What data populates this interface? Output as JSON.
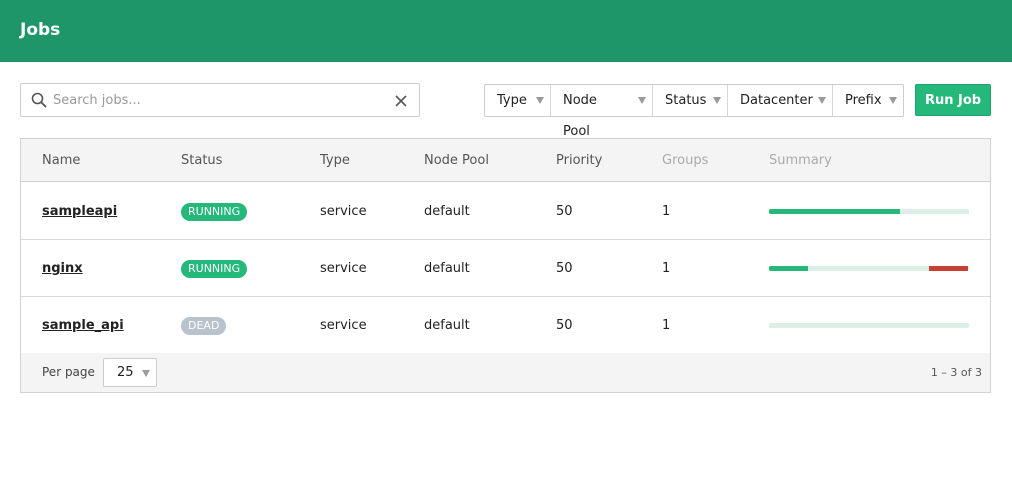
{
  "header": {
    "title": "Jobs",
    "color": "#1e966a"
  },
  "search": {
    "placeholder": "Search jobs...",
    "value": "",
    "icon": "search-icon",
    "clear_icon": "close-icon"
  },
  "filters": [
    {
      "label": "Type"
    },
    {
      "label": "Node Pool"
    },
    {
      "label": "Status"
    },
    {
      "label": "Datacenter"
    },
    {
      "label": "Prefix"
    }
  ],
  "actions": {
    "run_job": "Run Job",
    "color": "#25b87b"
  },
  "table": {
    "columns": [
      "Name",
      "Status",
      "Type",
      "Node Pool",
      "Priority",
      "Groups",
      "Summary"
    ],
    "rows": [
      {
        "name": "sampleapi",
        "status": "RUNNING",
        "type": "service",
        "node_pool": "default",
        "priority": "50",
        "groups": "1",
        "summary": [
          {
            "state": "running",
            "fraction": 0.66,
            "color": "#25b87b"
          },
          {
            "state": "empty",
            "fraction": 0.34,
            "color": "#dcefe7"
          }
        ]
      },
      {
        "name": "nginx",
        "status": "RUNNING",
        "type": "service",
        "node_pool": "default",
        "priority": "50",
        "groups": "1",
        "summary": [
          {
            "state": "running",
            "fraction": 0.2,
            "color": "#25b87b"
          },
          {
            "state": "empty",
            "fraction": 0.6,
            "color": "#dcefe7"
          },
          {
            "state": "failed",
            "fraction": 0.2,
            "color": "#c84034"
          }
        ]
      },
      {
        "name": "sample_api",
        "status": "DEAD",
        "type": "service",
        "node_pool": "default",
        "priority": "50",
        "groups": "1",
        "summary": [
          {
            "state": "empty",
            "fraction": 1.0,
            "color": "#dcefe7"
          }
        ]
      }
    ]
  },
  "footer": {
    "per_page_label": "Per page",
    "per_page_value": "25",
    "range": "1 – 3 of 3"
  }
}
